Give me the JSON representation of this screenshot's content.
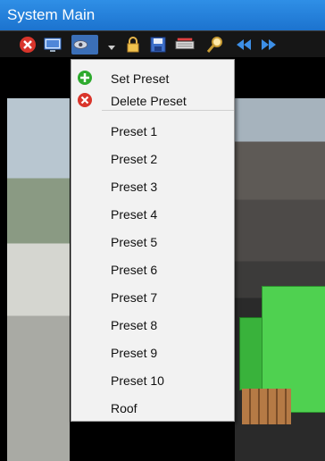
{
  "window": {
    "title": "System Main"
  },
  "toolbar": {
    "buttons": [
      {
        "icon": "close-red-icon"
      },
      {
        "icon": "monitor-icon"
      },
      {
        "icon": "ptz-eye-icon"
      },
      {
        "icon": "dropdown-arrow-icon"
      },
      {
        "icon": "lock-icon"
      },
      {
        "icon": "save-icon"
      },
      {
        "icon": "keyboard-icon"
      },
      {
        "icon": "zoom-icon"
      },
      {
        "icon": "rewind-icon"
      },
      {
        "icon": "forward-icon"
      }
    ]
  },
  "menu": {
    "set_preset": "Set Preset",
    "delete_preset": "Delete Preset",
    "presets": [
      "Preset 1",
      "Preset 2",
      "Preset 3",
      "Preset 4",
      "Preset 5",
      "Preset 6",
      "Preset 7",
      "Preset 8",
      "Preset 9",
      "Preset 10",
      "Roof"
    ]
  },
  "colors": {
    "accent": "#1c73cf",
    "add": "#2eaa2e",
    "delete": "#d9352b"
  }
}
